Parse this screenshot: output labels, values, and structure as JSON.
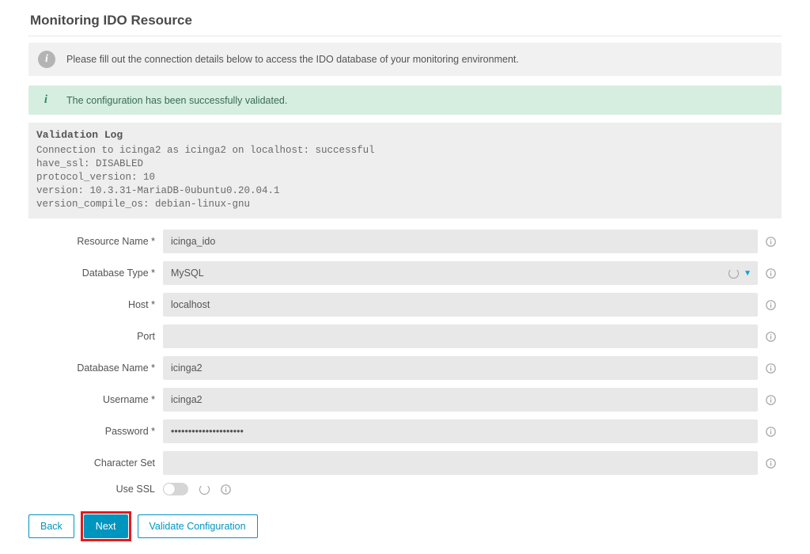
{
  "header": {
    "title": "Monitoring IDO Resource"
  },
  "notice": {
    "text": "Please fill out the connection details below to access the IDO database of your monitoring environment."
  },
  "success": {
    "text": "The configuration has been successfully validated."
  },
  "vlog": {
    "title": "Validation Log",
    "body": "Connection to icinga2 as icinga2 on localhost: successful\nhave_ssl: DISABLED\nprotocol_version: 10\nversion: 10.3.31-MariaDB-0ubuntu0.20.04.1\nversion_compile_os: debian-linux-gnu"
  },
  "form": {
    "resource_name": {
      "label": "Resource Name *",
      "value": "icinga_ido"
    },
    "database_type": {
      "label": "Database Type *",
      "value": "MySQL"
    },
    "host": {
      "label": "Host *",
      "value": "localhost"
    },
    "port": {
      "label": "Port",
      "value": ""
    },
    "database_name": {
      "label": "Database Name *",
      "value": "icinga2"
    },
    "username": {
      "label": "Username *",
      "value": "icinga2"
    },
    "password": {
      "label": "Password *",
      "value": "•••••••••••••••••••••"
    },
    "character_set": {
      "label": "Character Set",
      "value": ""
    },
    "use_ssl": {
      "label": "Use SSL",
      "value": false
    }
  },
  "buttons": {
    "back": "Back",
    "next": "Next",
    "validate": "Validate Configuration"
  }
}
